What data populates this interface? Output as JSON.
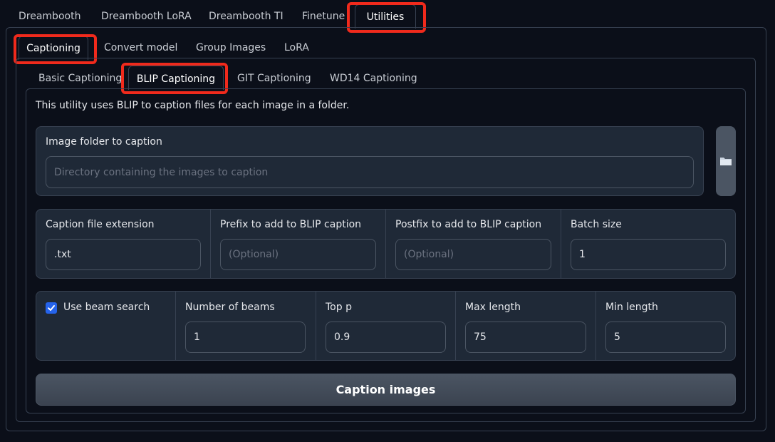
{
  "main_tabs": [
    "Dreambooth",
    "Dreambooth LoRA",
    "Dreambooth TI",
    "Finetune",
    "Utilities"
  ],
  "utility_tabs": [
    "Captioning",
    "Convert model",
    "Group Images",
    "LoRA"
  ],
  "caption_tabs": [
    "Basic Captioning",
    "BLIP Captioning",
    "GIT Captioning",
    "WD14 Captioning"
  ],
  "description": "This utility uses BLIP to caption files for each image in a folder.",
  "image_folder": {
    "label": "Image folder to caption",
    "placeholder": "Directory containing the images to caption",
    "value": ""
  },
  "caption_ext": {
    "label": "Caption file extension",
    "value": ".txt"
  },
  "prefix": {
    "label": "Prefix to add to BLIP caption",
    "placeholder": "(Optional)"
  },
  "postfix": {
    "label": "Postfix to add to BLIP caption",
    "placeholder": "(Optional)"
  },
  "batch_size": {
    "label": "Batch size",
    "value": "1"
  },
  "beam_search": {
    "label": "Use beam search",
    "checked": true
  },
  "num_beams": {
    "label": "Number of beams",
    "value": "1"
  },
  "top_p": {
    "label": "Top p",
    "value": "0.9"
  },
  "max_length": {
    "label": "Max length",
    "value": "75"
  },
  "min_length": {
    "label": "Min length",
    "value": "5"
  },
  "run_button": "Caption images",
  "colors": {
    "background": "#0b0f19",
    "block": "#1f2937",
    "accent": "#2563eb",
    "highlight": "#f02a1c"
  }
}
